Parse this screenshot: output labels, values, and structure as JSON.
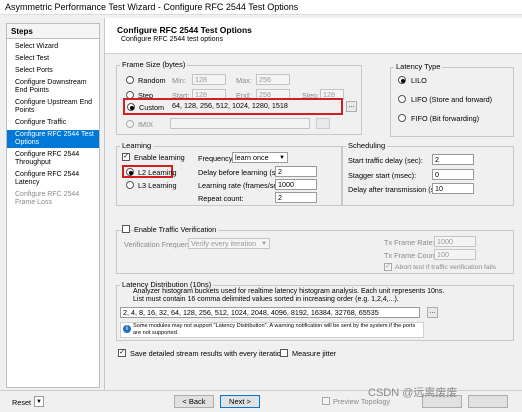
{
  "window_title": "Asymmetric Performance Test Wizard - Configure RFC 2544 Test Options",
  "steps": {
    "header": "Steps",
    "items": [
      {
        "label": "Select Wizard",
        "state": "normal"
      },
      {
        "label": "Select Test",
        "state": "normal"
      },
      {
        "label": "Select Ports",
        "state": "normal"
      },
      {
        "label": "Configure Downstream End Points",
        "state": "normal"
      },
      {
        "label": "Configure Upstream End Points",
        "state": "normal"
      },
      {
        "label": "Configure Traffic",
        "state": "normal"
      },
      {
        "label": "Configure RFC 2544 Test Options",
        "state": "active"
      },
      {
        "label": "Configure RFC 2544 Throughput",
        "state": "normal"
      },
      {
        "label": "Configure RFC 2544 Latency",
        "state": "normal"
      },
      {
        "label": "Configure RFC 2544 Frame Loss",
        "state": "disabled"
      }
    ]
  },
  "header": {
    "title": "Configure RFC 2544 Test Options",
    "subtitle": "Configure RFC 2544 test options"
  },
  "frame_size": {
    "legend": "Frame Size (bytes)",
    "random_label": "Random",
    "min_label": "Min:",
    "min_value": "128",
    "max_label": "Max:",
    "max_value": "256",
    "step_label": "Step",
    "start_label": "Start:",
    "start_value": "128",
    "end_label": "End:",
    "end_value": "256",
    "step_field_label": "Step:",
    "step_value": "128",
    "custom_label": "Custom",
    "custom_value": "64, 128, 256, 512, 1024, 1280, 1518",
    "imix_label": "IMIX",
    "ellipsis": "..."
  },
  "latency_type": {
    "legend": "Latency Type",
    "options": [
      "LILO",
      "LIFO  (Store and forward)",
      "FIFO  (Bit forwarding)"
    ],
    "selected": "LILO"
  },
  "learning": {
    "legend": "Learning",
    "enable_label": "Enable learning",
    "enable_checked": "✓",
    "l2_label": "L2 Learning",
    "l3_label": "L3 Learning",
    "frequency_label": "Frequency:",
    "frequency_value": "learn once",
    "delay_label": "Delay before learning (sec):",
    "delay_value": "2",
    "rate_label": "Learning rate (frames/sec):",
    "rate_value": "1000",
    "repeat_label": "Repeat count:",
    "repeat_value": "2"
  },
  "scheduling": {
    "legend": "Scheduling",
    "traffic_delay_label": "Start traffic delay (sec):",
    "traffic_delay_value": "2",
    "stagger_label": "Stagger start (msec):",
    "stagger_value": "0",
    "delay_after_label": "Delay after transmission (sec):",
    "delay_after_value": "10"
  },
  "traffic_verification": {
    "enable_label": "Enable Traffic Verification",
    "frequency_label": "Verification Frequency:",
    "frequency_value": "Verify every iteration",
    "tx_rate_label": "Tx Frame Rate:",
    "tx_rate_value": "1000",
    "tx_count_label": "Tx Frame Count:",
    "tx_count_value": "100",
    "abort_label": "Abort test if traffic verification fails",
    "abort_checked": "✓"
  },
  "latency_distribution": {
    "legend": "Latency Distribution (10ns)",
    "description_1": "Analyzer histogram buckets used for realtime latency histogram analysis.  Each unit represents 10ns.",
    "description_2": "List must contain 16 comma delimited values sorted in increasing order (e.g. 1,2,4,...).",
    "value": "2, 4, 8, 16, 32, 64, 128, 256, 512, 1024, 2048, 4096, 8192, 16384, 32768, 65535",
    "warning": "Some modules may not support \"Latency Distribution\". A warning notification will be sent by the system if the ports are not supported.",
    "ellipsis": "..."
  },
  "options": {
    "save_detailed_label": "Save detailed stream results with every iteration",
    "save_detailed_checked": "✓",
    "measure_jitter_label": "Measure jitter"
  },
  "footer": {
    "reset_label": "Reset",
    "back_label": "< Back",
    "next_label": "Next >",
    "preview_label": "Preview Topology",
    "watermark": "CSDN @远离废废"
  },
  "colors": {
    "accent": "#0078d7",
    "highlight_box": "#d21f1f"
  }
}
